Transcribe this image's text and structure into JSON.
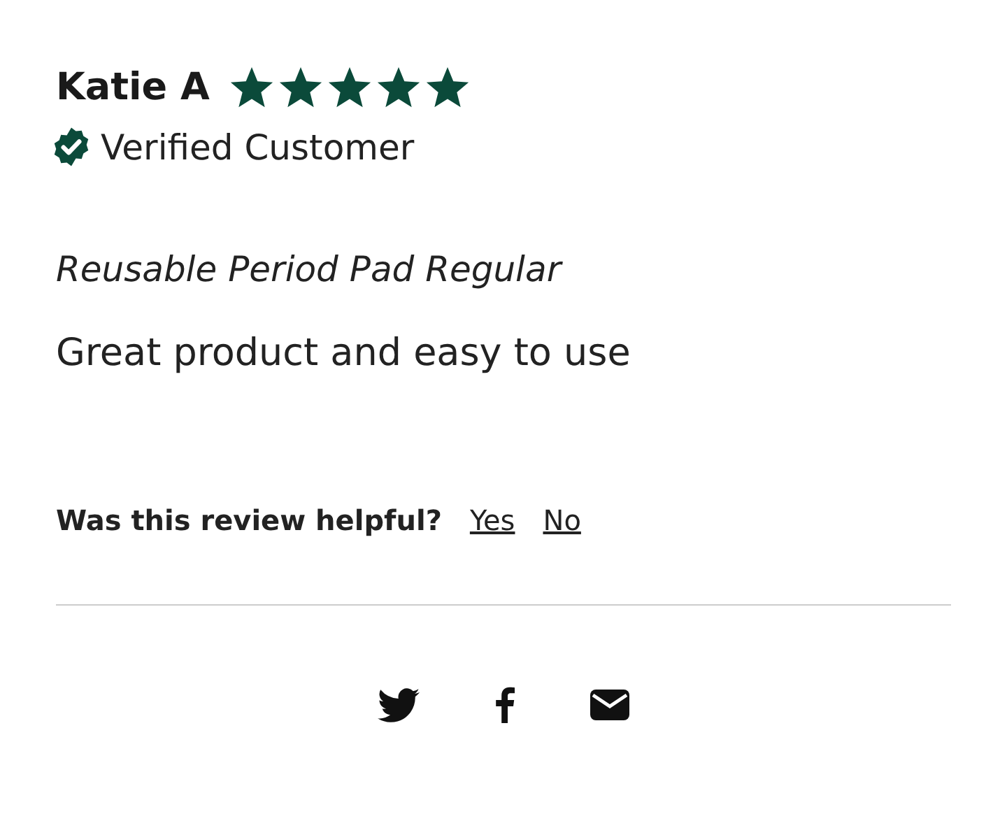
{
  "review": {
    "author": "Katie A",
    "stars": 5,
    "verified": true,
    "verified_label": "Verified Customer",
    "product": "Reusable Period Pad Regular",
    "body": "Great product and easy to use"
  },
  "helpful": {
    "question": "Was this review helpful?",
    "options": [
      "Yes",
      "No"
    ]
  },
  "share": [
    {
      "kind": "twitter"
    },
    {
      "kind": "facebook"
    },
    {
      "kind": "email"
    }
  ]
}
